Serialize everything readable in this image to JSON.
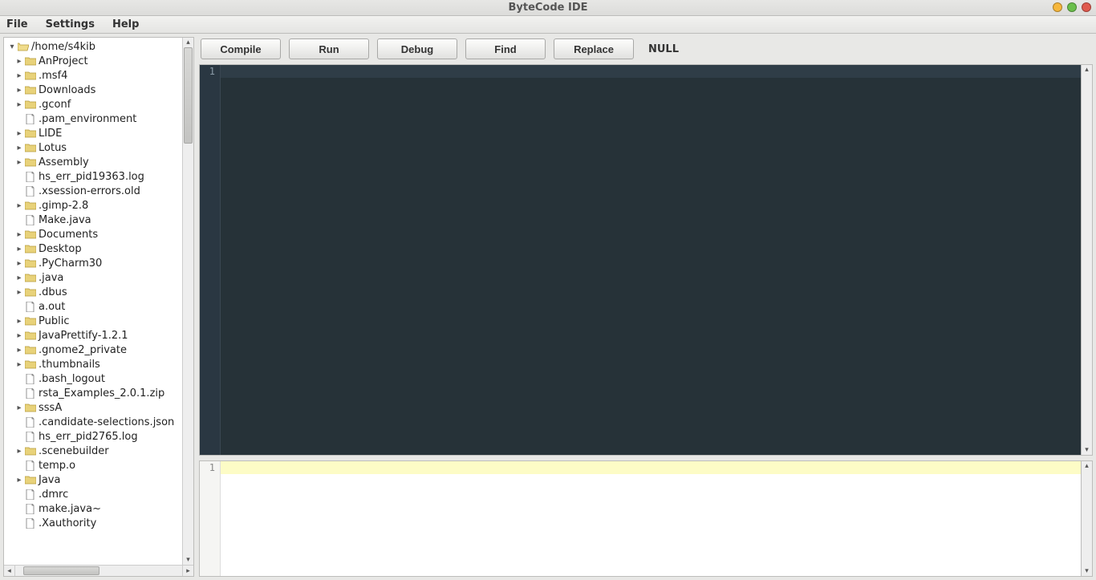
{
  "window": {
    "title": "ByteCode IDE"
  },
  "menubar": {
    "file": "File",
    "settings": "Settings",
    "help": "Help"
  },
  "toolbar": {
    "compile": "Compile",
    "run": "Run",
    "debug": "Debug",
    "find": "Find",
    "replace": "Replace",
    "status": "NULL"
  },
  "tree": {
    "root": {
      "name": "/home/s4kib",
      "type": "folder-open",
      "expanded": true
    },
    "items": [
      {
        "name": "AnProject",
        "type": "folder",
        "expandable": true
      },
      {
        "name": ".msf4",
        "type": "folder",
        "expandable": true
      },
      {
        "name": "Downloads",
        "type": "folder",
        "expandable": true
      },
      {
        "name": ".gconf",
        "type": "folder",
        "expandable": true
      },
      {
        "name": ".pam_environment",
        "type": "file",
        "expandable": false
      },
      {
        "name": "LIDE",
        "type": "folder",
        "expandable": true
      },
      {
        "name": "Lotus",
        "type": "folder",
        "expandable": true
      },
      {
        "name": "Assembly",
        "type": "folder",
        "expandable": true
      },
      {
        "name": "hs_err_pid19363.log",
        "type": "file",
        "expandable": false
      },
      {
        "name": ".xsession-errors.old",
        "type": "file",
        "expandable": false
      },
      {
        "name": ".gimp-2.8",
        "type": "folder",
        "expandable": true
      },
      {
        "name": "Make.java",
        "type": "file",
        "expandable": false
      },
      {
        "name": "Documents",
        "type": "folder",
        "expandable": true
      },
      {
        "name": "Desktop",
        "type": "folder",
        "expandable": true
      },
      {
        "name": ".PyCharm30",
        "type": "folder",
        "expandable": true
      },
      {
        "name": ".java",
        "type": "folder",
        "expandable": true
      },
      {
        "name": ".dbus",
        "type": "folder",
        "expandable": true
      },
      {
        "name": "a.out",
        "type": "file",
        "expandable": false
      },
      {
        "name": "Public",
        "type": "folder",
        "expandable": true
      },
      {
        "name": "JavaPrettify-1.2.1",
        "type": "folder",
        "expandable": true
      },
      {
        "name": ".gnome2_private",
        "type": "folder",
        "expandable": true
      },
      {
        "name": ".thumbnails",
        "type": "folder",
        "expandable": true
      },
      {
        "name": ".bash_logout",
        "type": "file",
        "expandable": false
      },
      {
        "name": "rsta_Examples_2.0.1.zip",
        "type": "file",
        "expandable": false
      },
      {
        "name": "sssA",
        "type": "folder",
        "expandable": true
      },
      {
        "name": ".candidate-selections.json",
        "type": "file",
        "expandable": false
      },
      {
        "name": "hs_err_pid2765.log",
        "type": "file",
        "expandable": false
      },
      {
        "name": ".scenebuilder",
        "type": "folder",
        "expandable": true
      },
      {
        "name": "temp.o",
        "type": "file",
        "expandable": false
      },
      {
        "name": "Java",
        "type": "folder",
        "expandable": true
      },
      {
        "name": ".dmrc",
        "type": "file",
        "expandable": false
      },
      {
        "name": "make.java~",
        "type": "file",
        "expandable": false
      },
      {
        "name": ".Xauthority",
        "type": "file",
        "expandable": false
      }
    ]
  },
  "editor": {
    "gutter_line": "1"
  },
  "output": {
    "gutter_line": "1"
  }
}
